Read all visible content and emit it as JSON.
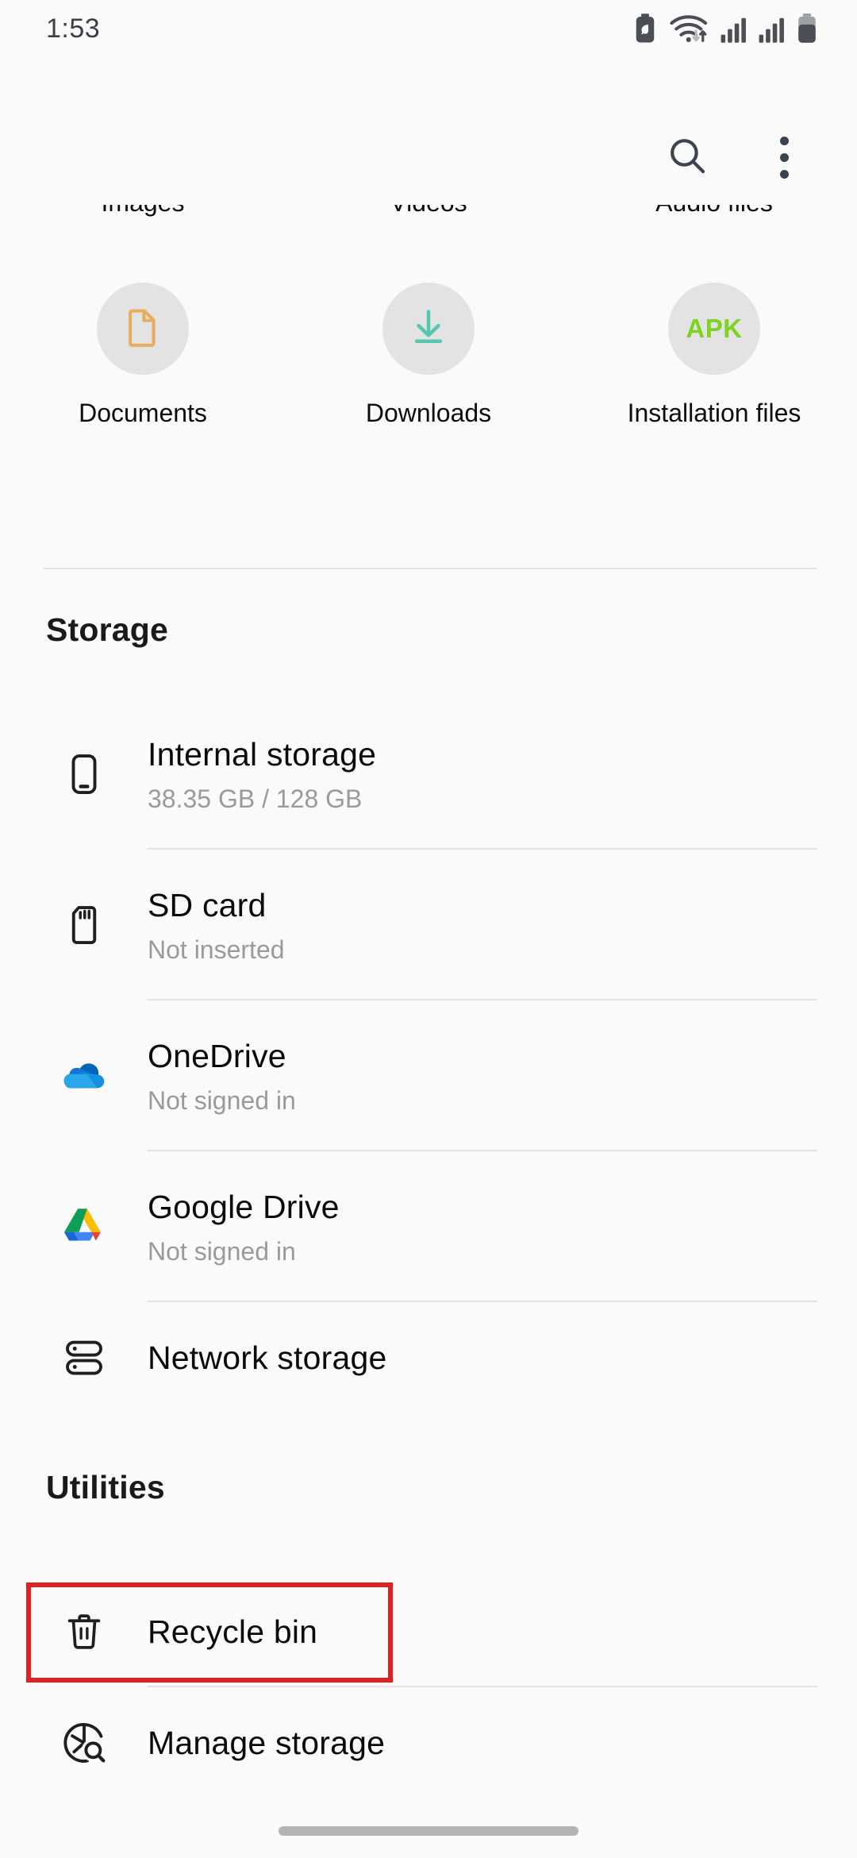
{
  "status_bar": {
    "time": "1:53",
    "icons": [
      "battery-saver-icon",
      "wifi-transfer-icon",
      "signal-bars-icon",
      "signal-bars-icon",
      "battery-icon"
    ]
  },
  "app_bar": {
    "search_icon": "search-icon",
    "overflow_icon": "more-vertical-icon"
  },
  "categories": {
    "row_top": [
      {
        "label": "Images"
      },
      {
        "label": "Videos"
      },
      {
        "label": "Audio files"
      }
    ],
    "row_bottom": [
      {
        "label": "Documents",
        "icon": "document-icon",
        "color": "#e8ad5c"
      },
      {
        "label": "Downloads",
        "icon": "download-arrow-icon",
        "color": "#54c7ae"
      },
      {
        "label": "Installation files",
        "icon": "apk-icon",
        "badge": "APK",
        "color": "#7ed321"
      }
    ]
  },
  "storage": {
    "heading": "Storage",
    "items": [
      {
        "title": "Internal storage",
        "subtitle": "38.35 GB / 128 GB",
        "icon": "phone-icon"
      },
      {
        "title": "SD card",
        "subtitle": "Not inserted",
        "icon": "sd-card-icon"
      },
      {
        "title": "OneDrive",
        "subtitle": "Not signed in",
        "icon": "onedrive-icon"
      },
      {
        "title": "Google Drive",
        "subtitle": "Not signed in",
        "icon": "google-drive-icon"
      },
      {
        "title": "Network storage",
        "subtitle": "",
        "icon": "network-storage-icon"
      }
    ]
  },
  "utilities": {
    "heading": "Utilities",
    "items": [
      {
        "title": "Recycle bin",
        "icon": "trash-icon",
        "highlighted": true
      },
      {
        "title": "Manage storage",
        "icon": "storage-analysis-icon",
        "highlighted": false
      }
    ]
  },
  "highlight": {
    "color": "#e02020"
  },
  "nav": {
    "home_indicator": "home-gesture-bar"
  }
}
